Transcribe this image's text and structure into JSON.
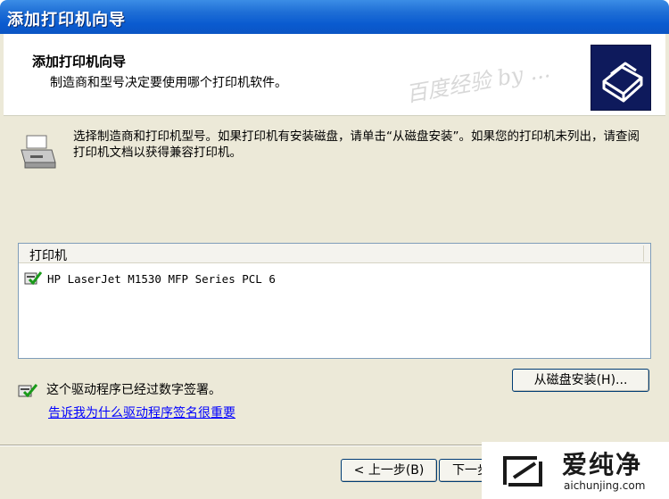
{
  "window": {
    "title": "添加打印机向导"
  },
  "header": {
    "title": "添加打印机向导",
    "subtitle": "制造商和型号决定要使用哪个打印机软件。",
    "watermark": "百度经验 by ...",
    "icon": "printer-wizard-icon"
  },
  "intro": {
    "text": "选择制造商和打印机型号。如果打印机有安装磁盘，请单击“从磁盘安装”。如果您的打印机未列出，请查阅打印机文档以获得兼容打印机。",
    "icon": "printer-icon"
  },
  "printer_list": {
    "column_header": "打印机",
    "items": [
      {
        "label": "HP LaserJet M1530 MFP Series PCL 6",
        "icon": "signed-driver-check-icon"
      }
    ]
  },
  "signature": {
    "text": "这个驱动程序已经过数字签署。",
    "link": "告诉我为什么驱动程序签名很重要",
    "icon": "signed-driver-icon"
  },
  "buttons": {
    "have_disk": "从磁盘安装(H)...",
    "back": "< 上一步(B)",
    "next": "下一步"
  },
  "logo": {
    "name": "爱纯净",
    "url": "aichunjing.com"
  },
  "colors": {
    "titlebar": "#0a5bd0",
    "window_bg": "#ece9d8",
    "link": "#0000ff"
  }
}
